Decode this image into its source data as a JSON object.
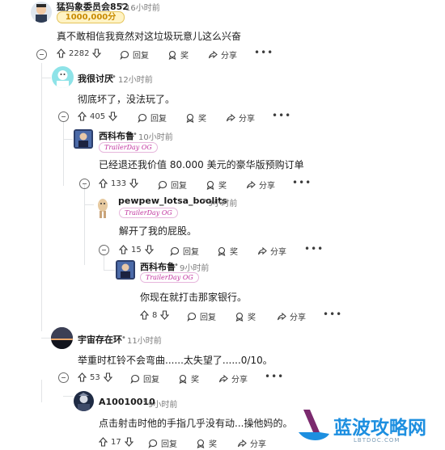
{
  "comments": [
    {
      "user": "猛犸象委员会852",
      "time": "16小时前",
      "badge": "1000,000分",
      "text": "真不敢相信我竟然对这垃圾玩意儿这么兴奋",
      "votes": "2282"
    },
    {
      "user": "我很讨厌",
      "time": "12小时前",
      "text": "彻底坏了，没法玩了。",
      "votes": "405"
    },
    {
      "user": "西科布鲁",
      "time": "10小时前",
      "flair": "TrailerDay OG",
      "text": "已经退还我价值 80.000 美元的豪华版预购订单",
      "votes": "133"
    },
    {
      "user": "pewpew_lotsa_boolits",
      "time": "9小时前",
      "flair": "TrailerDay OG",
      "text": "解开了我的屁股。",
      "votes": "15"
    },
    {
      "user": "西科布鲁",
      "time": "9小时前",
      "flair": "TrailerDay OG",
      "text": "你现在就打击那家银行。",
      "votes": "8"
    },
    {
      "user": "宇宙存在环",
      "time": "11小时前",
      "text": "举重时杠铃不会弯曲......太失望了......0/10。",
      "votes": "53"
    },
    {
      "user": "A10010010",
      "time": "9小时前",
      "text": "点击射击时他的手指几乎没有动...操他妈的。",
      "votes": "17"
    }
  ],
  "actions": {
    "reply": "回复",
    "award": "奖",
    "share": "分享",
    "more": "•••",
    "sep": "•"
  },
  "watermark": {
    "title": "蓝波攻略网",
    "url": "LBTDOC.COM"
  },
  "colors": {
    "link_accent": "#1d8fe0",
    "flair": "#c0329e"
  }
}
